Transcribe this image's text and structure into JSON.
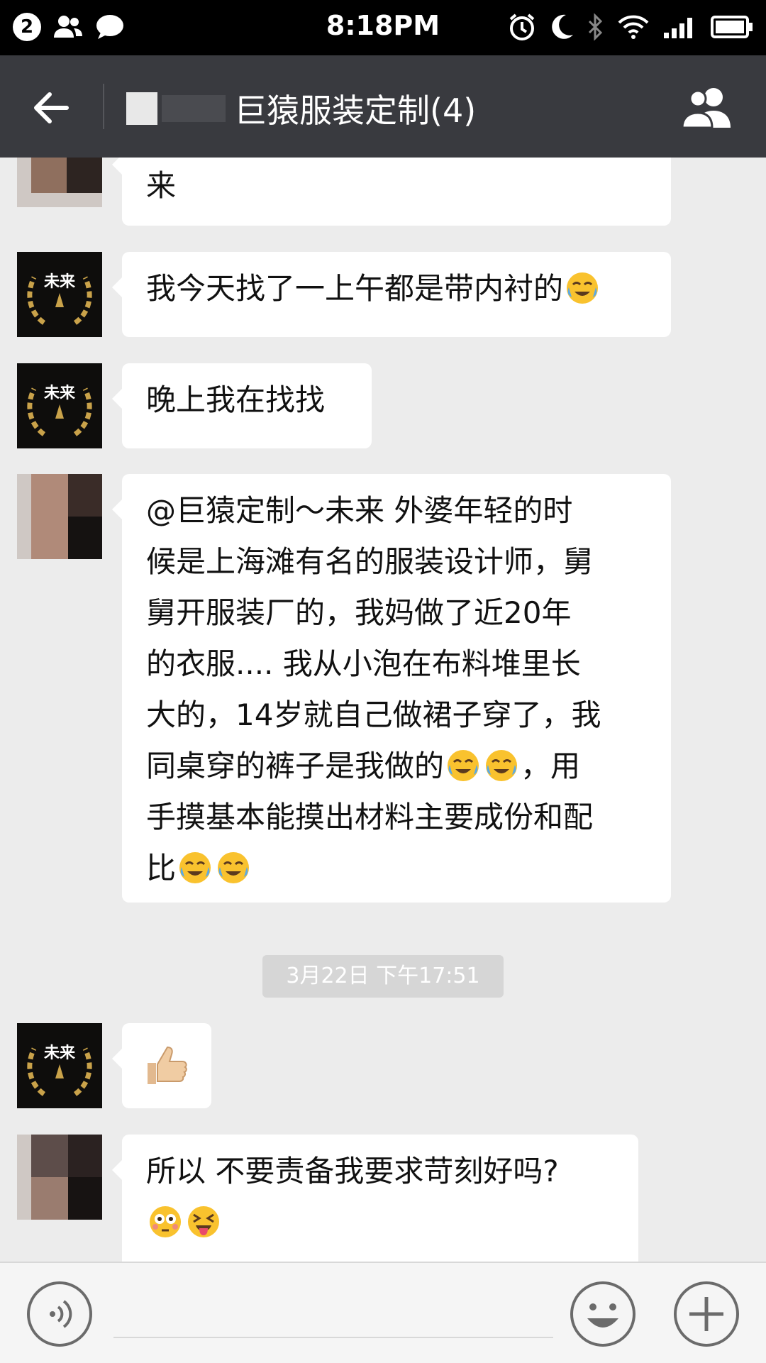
{
  "status_bar": {
    "notification_count": "2",
    "time": "8:18PM"
  },
  "header": {
    "title": "巨猿服装定制(4)"
  },
  "messages": [
    {
      "sender": "other-user",
      "lines": [
        "来"
      ]
    },
    {
      "sender": "futures",
      "lines": [
        "我今天找了一上午都是带内衬的"
      ]
    },
    {
      "sender": "futures",
      "lines": [
        "晚上我在找找"
      ]
    },
    {
      "sender": "other-user",
      "lines": [
        "@巨猿定制～未来  外婆年轻的时",
        "候是上海滩有名的服装设计师，舅",
        "舅开服装厂的，我妈做了近20年",
        "的衣服.... 我从小泡在布料堆里长",
        "大的，14岁就自己做裙子穿了，我",
        "同桌穿的裤子是我做的",
        "，用",
        "手摸基本能摸出材料主要成份和配",
        "比"
      ]
    },
    {
      "sender": "futures",
      "lines": []
    },
    {
      "sender": "other-user",
      "lines": [
        "所以 不要责备我要求苛刻好吗?"
      ]
    }
  ],
  "avatar": {
    "label": "未来"
  },
  "timestamp": "3月22日 下午17:51",
  "icons": {
    "back": "arrow-left-icon",
    "group": "people-icon",
    "voice": "voice-icon",
    "emoji": "smile-icon",
    "plus": "plus-icon"
  },
  "colors": {
    "header_bg": "#393a3f",
    "status_bg": "#000000",
    "chat_bg": "#ececec",
    "bubble_bg": "#ffffff",
    "timestamp_bg": "#d6d6d6",
    "avatar_gold": "#c9a24a"
  }
}
